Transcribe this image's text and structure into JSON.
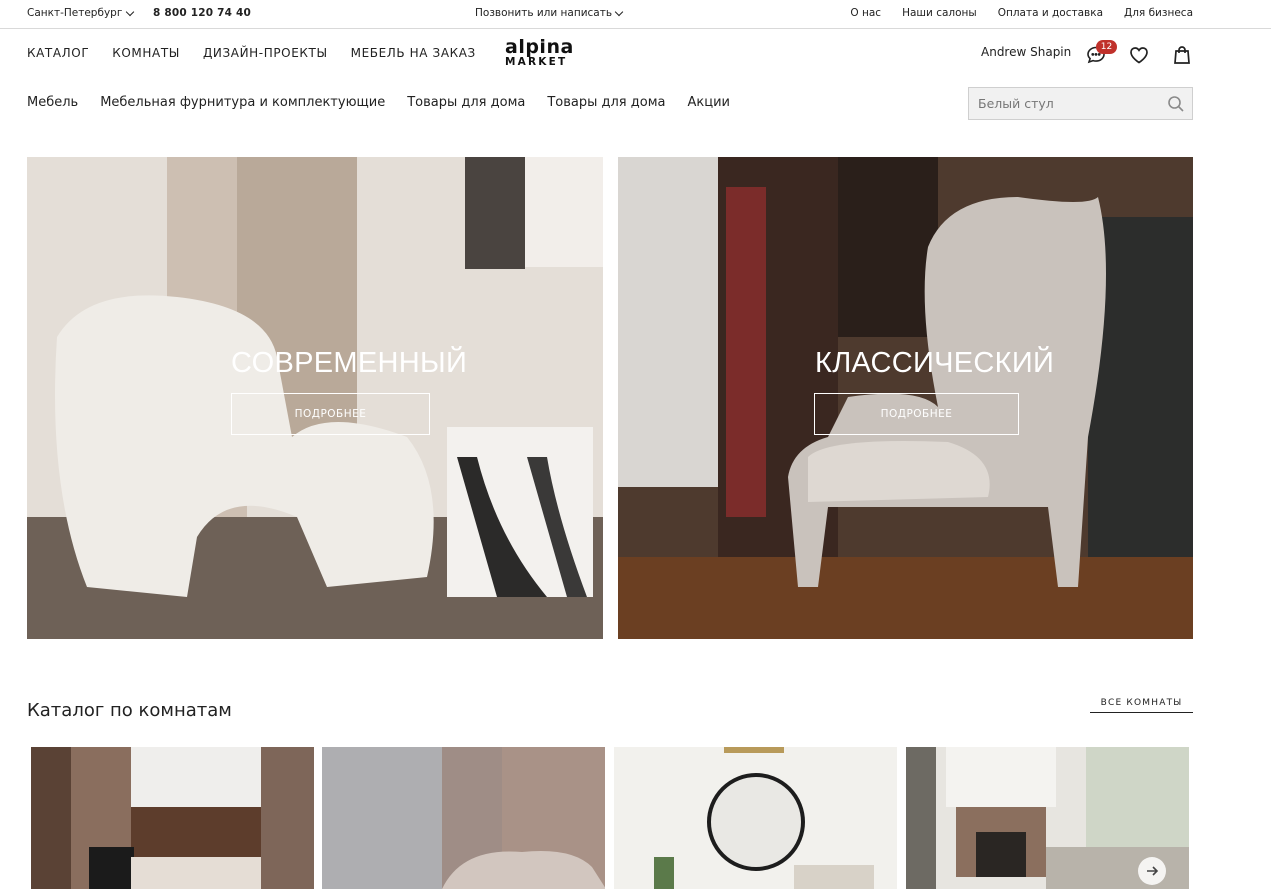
{
  "topbar": {
    "city": "Санкт-Петербург",
    "phone": "8 800 120 74 40",
    "call": "Позвонить или написать",
    "links": [
      "О нас",
      "Наши салоны",
      "Оплата и доставка",
      "Для бизнеса"
    ]
  },
  "header": {
    "nav": [
      "КАТАЛОГ",
      "КОМНАТЫ",
      "ДИЗАЙН-ПРОЕКТЫ",
      "МЕБЕЛЬ НА ЗАКАЗ"
    ],
    "logo_line1": "alpina",
    "logo_line2": "MARKET",
    "user": "Andrew Shapin",
    "chat_badge": "12"
  },
  "subnav": [
    "Мебель",
    "Мебельная фурнитура и комплектующие",
    "Товары для дома",
    "Товары для дома",
    "Акции"
  ],
  "search": {
    "placeholder": "Белый стул"
  },
  "hero": [
    {
      "title": "СОВРЕМЕННЫЙ",
      "button": "ПОДРОБНЕЕ"
    },
    {
      "title": "КЛАССИЧЕСКИЙ",
      "button": "ПОДРОБНЕЕ"
    }
  ],
  "rooms": {
    "title": "Каталог по комнатам",
    "all_link": "ВСЕ КОМНАТЫ"
  },
  "colors": {
    "badge": "#c0312b",
    "text": "#222222",
    "border": "#d9d9d9"
  },
  "icons": [
    "chevron-down-icon",
    "chat-icon",
    "heart-icon",
    "bag-icon",
    "search-icon",
    "arrow-right-icon"
  ]
}
